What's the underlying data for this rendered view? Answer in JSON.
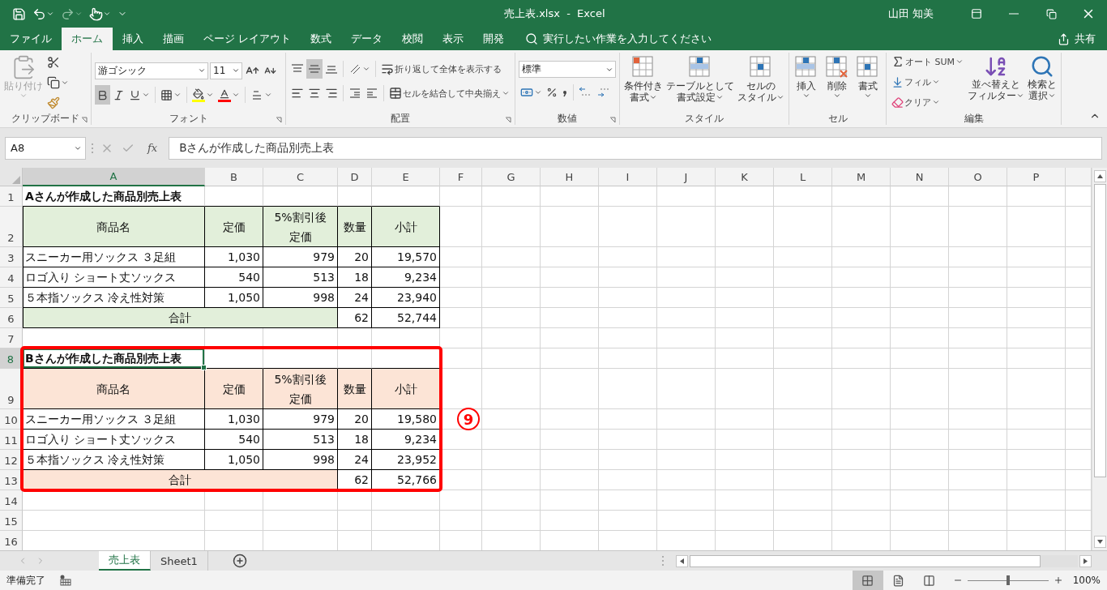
{
  "title_bar": {
    "title": "売上表.xlsx  -  Excel",
    "user": "山田 知美"
  },
  "menu_tabs": [
    {
      "label": "ファイル",
      "selected": false
    },
    {
      "label": "ホーム",
      "selected": true
    },
    {
      "label": "挿入",
      "selected": false
    },
    {
      "label": "描画",
      "selected": false
    },
    {
      "label": "ページ レイアウト",
      "selected": false
    },
    {
      "label": "数式",
      "selected": false
    },
    {
      "label": "データ",
      "selected": false
    },
    {
      "label": "校閲",
      "selected": false
    },
    {
      "label": "表示",
      "selected": false
    },
    {
      "label": "開発",
      "selected": false
    }
  ],
  "tell_me": {
    "placeholder": "実行したい作業を入力してください"
  },
  "share": "共有",
  "ribbon": {
    "clipboard": {
      "label": "クリップボード",
      "paste": {
        "label": "貼り付け",
        "disabled": true
      }
    },
    "font": {
      "label": "フォント",
      "name": "游ゴシック",
      "size": "11",
      "bold": true,
      "italic": false,
      "underline": false
    },
    "alignment": {
      "label": "配置",
      "wrap": "折り返して全体を表示する",
      "merge": "セルを結合して中央揃え",
      "vertical": [
        {
          "selected": false
        },
        {
          "selected": true
        },
        {
          "selected": false
        }
      ]
    },
    "number": {
      "label": "数値",
      "format": "標準"
    },
    "styles": {
      "label": "スタイル",
      "buttons": [
        [
          "条件付き",
          "書式"
        ],
        [
          "テーブルとして",
          "書式設定"
        ],
        [
          "セルの",
          "スタイル"
        ]
      ]
    },
    "cells": {
      "label": "セル",
      "buttons": [
        "挿入",
        "削除",
        "書式"
      ]
    },
    "editing": {
      "label": "編集",
      "items": [
        "オート SUM",
        "フィル",
        "クリア"
      ],
      "buttons": [
        [
          "並べ替えと",
          "フィルター"
        ],
        [
          "検索と",
          "選択"
        ]
      ]
    }
  },
  "formula_bar": {
    "name_box": "A8",
    "fx": "fx",
    "value": "Bさんが作成した商品別売上表"
  },
  "sheet": {
    "columns": [
      {
        "label": "A",
        "selected": true
      },
      {
        "label": "B",
        "selected": false
      },
      {
        "label": "C",
        "selected": false
      },
      {
        "label": "D",
        "selected": false
      },
      {
        "label": "E",
        "selected": false
      },
      {
        "label": "F",
        "selected": false
      },
      {
        "label": "G",
        "selected": false
      },
      {
        "label": "H",
        "selected": false
      },
      {
        "label": "I",
        "selected": false
      },
      {
        "label": "J",
        "selected": false
      },
      {
        "label": "K",
        "selected": false
      },
      {
        "label": "L",
        "selected": false
      },
      {
        "label": "M",
        "selected": false
      },
      {
        "label": "N",
        "selected": false
      },
      {
        "label": "O",
        "selected": false
      },
      {
        "label": "P",
        "selected": false
      }
    ],
    "rows": [
      {
        "label": "1",
        "selected": false
      },
      {
        "label": "2",
        "selected": false
      },
      {
        "label": "3",
        "selected": false
      },
      {
        "label": "4",
        "selected": false
      },
      {
        "label": "5",
        "selected": false
      },
      {
        "label": "6",
        "selected": false
      },
      {
        "label": "7",
        "selected": false
      },
      {
        "label": "8",
        "selected": true
      },
      {
        "label": "9",
        "selected": false
      },
      {
        "label": "10",
        "selected": false
      },
      {
        "label": "11",
        "selected": false
      },
      {
        "label": "12",
        "selected": false
      },
      {
        "label": "13",
        "selected": false
      },
      {
        "label": "14",
        "selected": false
      },
      {
        "label": "15",
        "selected": false
      },
      {
        "label": "16",
        "selected": false
      }
    ],
    "tables": [
      {
        "title": "Aさんが作成した商品別売上表",
        "color": "#e2efda",
        "highlighted": false,
        "header": [
          [
            "商品名"
          ],
          [
            "定価"
          ],
          [
            "5%割引後",
            "定価"
          ],
          [
            "数量"
          ],
          [
            "小計"
          ]
        ],
        "rows": [
          [
            "スニーカー用ソックス ３足組",
            "1,030",
            "979",
            "20",
            "19,570"
          ],
          [
            "ロゴ入り ショート丈ソックス",
            "540",
            "513",
            "18",
            "9,234"
          ],
          [
            "５本指ソックス 冷え性対策",
            "1,050",
            "998",
            "24",
            "23,940"
          ]
        ],
        "total": [
          "合計",
          "62",
          "52,744"
        ]
      },
      {
        "title": "Bさんが作成した商品別売上表",
        "color": "#fce4d6",
        "highlighted": true,
        "annotation": "9",
        "header": [
          [
            "商品名"
          ],
          [
            "定価"
          ],
          [
            "5%割引後",
            "定価"
          ],
          [
            "数量"
          ],
          [
            "小計"
          ]
        ],
        "rows": [
          [
            "スニーカー用ソックス ３足組",
            "1,030",
            "979",
            "20",
            "19,580"
          ],
          [
            "ロゴ入り ショート丈ソックス",
            "540",
            "513",
            "18",
            "9,234"
          ],
          [
            "５本指ソックス 冷え性対策",
            "1,050",
            "998",
            "24",
            "23,952"
          ]
        ],
        "total": [
          "合計",
          "62",
          "52,766"
        ]
      }
    ]
  },
  "sheet_tabs": [
    {
      "label": "売上表",
      "selected": true
    },
    {
      "label": "Sheet1",
      "selected": false
    }
  ],
  "status_bar": {
    "text": "準備完了",
    "views": [
      {
        "selected": true
      },
      {
        "selected": false
      },
      {
        "selected": false
      }
    ],
    "zoom": {
      "level": 0.5,
      "reading": "100%"
    }
  }
}
